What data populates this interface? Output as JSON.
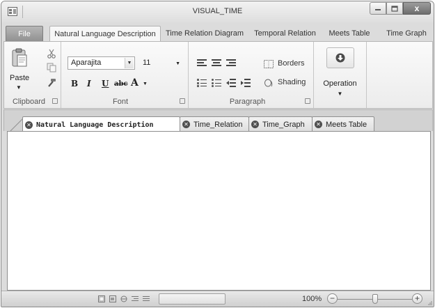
{
  "window": {
    "title": "VISUAL_TIME",
    "controls": {
      "minimize": "minimize-icon",
      "maximize": "maximize-icon",
      "close": "x"
    }
  },
  "ribbon_tabs": [
    {
      "label": "File"
    },
    {
      "label": "Natural Language Description"
    },
    {
      "label": "Time Relation Diagram"
    },
    {
      "label": "Temporal Relation"
    },
    {
      "label": "Meets Table"
    },
    {
      "label": "Time Graph"
    }
  ],
  "active_ribbon_tab": "Natural Language Description",
  "clipboard": {
    "group_label": "Clipboard",
    "paste_label": "Paste",
    "icons": [
      "paste-icon",
      "cut-icon",
      "copy-icon",
      "format-painter-icon"
    ]
  },
  "font": {
    "group_label": "Font",
    "font_name": "Aparajita",
    "font_size": "11",
    "bold": "B",
    "italic": "I",
    "underline": "U",
    "strikethrough": "abc",
    "font_color": "A"
  },
  "paragraph": {
    "group_label": "Paragraph",
    "borders_label": "Borders",
    "shading_label": "Shading",
    "icons": [
      "align-left-icon",
      "align-center-icon",
      "align-right-icon",
      "numbered-list-icon",
      "bulleted-list-icon",
      "decrease-indent-icon",
      "increase-indent-icon",
      "borders-icon",
      "shading-icon"
    ]
  },
  "operation": {
    "label": "Operation"
  },
  "doc_tabs": [
    {
      "label": "Natural Language Description",
      "active": true
    },
    {
      "label": "Time_Relation",
      "active": false
    },
    {
      "label": "Time_Graph",
      "active": false
    },
    {
      "label": "Meets Table",
      "active": false
    }
  ],
  "statusbar": {
    "zoom": "100%",
    "zoom_minus": "−",
    "zoom_plus": "+",
    "view_icons": [
      "print-layout-icon",
      "full-screen-icon",
      "web-layout-icon",
      "outline-icon",
      "draft-icon"
    ]
  },
  "colors": {
    "chrome": "#dcdcdc",
    "file_tab": "#a3a3a3",
    "close_button": "#7a7a7a",
    "document": "#ffffff"
  }
}
